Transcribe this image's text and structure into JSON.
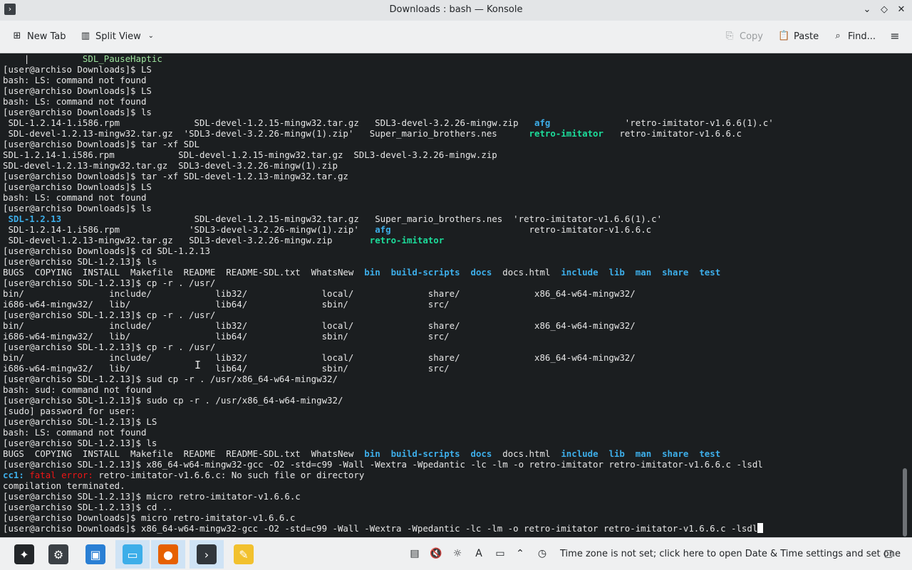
{
  "window": {
    "title": "Downloads : bash — Konsole",
    "controls": [
      "chevron-down",
      "diamond",
      "close"
    ]
  },
  "toolbar": {
    "new_tab": "New Tab",
    "split_view": "Split View",
    "copy": "Copy",
    "paste": "Paste",
    "find": "Find..."
  },
  "terminal": {
    "lines": [
      [
        {
          "t": "    |          "
        },
        {
          "t": "SDL_PauseHaptic",
          "c": "pale-green"
        }
      ],
      [
        {
          "t": "[user@archiso Downloads]$ LS"
        }
      ],
      [
        {
          "t": "bash: LS: command not found"
        }
      ],
      [
        {
          "t": "[user@archiso Downloads]$ LS"
        }
      ],
      [
        {
          "t": "bash: LS: command not found"
        }
      ],
      [
        {
          "t": "[user@archiso Downloads]$ ls"
        }
      ],
      [
        {
          "t": " SDL-1.2.14-1.i586.rpm              SDL-devel-1.2.15-mingw32.tar.gz   SDL3-devel-3.2.26-mingw.zip   "
        },
        {
          "t": "afg",
          "c": "blue"
        },
        {
          "t": "              'retro-imitator-v1.6.6(1).c'"
        }
      ],
      [
        {
          "t": " SDL-devel-1.2.13-mingw32.tar.gz  'SDL3-devel-3.2.26-mingw(1).zip'   Super_mario_brothers.nes      "
        },
        {
          "t": "retro-imitator",
          "c": "green"
        },
        {
          "t": "   retro-imitator-v1.6.6.c"
        }
      ],
      [
        {
          "t": "[user@archiso Downloads]$ tar -xf SDL"
        }
      ],
      [
        {
          "t": "SDL-1.2.14-1.i586.rpm            SDL-devel-1.2.15-mingw32.tar.gz  SDL3-devel-3.2.26-mingw.zip"
        }
      ],
      [
        {
          "t": "SDL-devel-1.2.13-mingw32.tar.gz  SDL3-devel-3.2.26-mingw(1).zip"
        }
      ],
      [
        {
          "t": "[user@archiso Downloads]$ tar -xf SDL-devel-1.2.13-mingw32.tar.gz"
        }
      ],
      [
        {
          "t": "[user@archiso Downloads]$ LS"
        }
      ],
      [
        {
          "t": "bash: LS: command not found"
        }
      ],
      [
        {
          "t": "[user@archiso Downloads]$ ls"
        }
      ],
      [
        {
          "t": " "
        },
        {
          "t": "SDL-1.2.13",
          "c": "blue"
        },
        {
          "t": "                         SDL-devel-1.2.15-mingw32.tar.gz   Super_mario_brothers.nes  'retro-imitator-v1.6.6(1).c'"
        }
      ],
      [
        {
          "t": " SDL-1.2.14-1.i586.rpm             'SDL3-devel-3.2.26-mingw(1).zip'   "
        },
        {
          "t": "afg",
          "c": "blue"
        },
        {
          "t": "                          retro-imitator-v1.6.6.c"
        }
      ],
      [
        {
          "t": " SDL-devel-1.2.13-mingw32.tar.gz   SDL3-devel-3.2.26-mingw.zip       "
        },
        {
          "t": "retro-imitator",
          "c": "green"
        }
      ],
      [
        {
          "t": "[user@archiso Downloads]$ cd SDL-1.2.13"
        }
      ],
      [
        {
          "t": "[user@archiso SDL-1.2.13]$ ls"
        }
      ],
      [
        {
          "t": "BUGS  COPYING  INSTALL  Makefile  README  README-SDL.txt  WhatsNew  "
        },
        {
          "t": "bin",
          "c": "blue"
        },
        {
          "t": "  "
        },
        {
          "t": "build-scripts",
          "c": "blue"
        },
        {
          "t": "  "
        },
        {
          "t": "docs",
          "c": "blue"
        },
        {
          "t": "  docs.html  "
        },
        {
          "t": "include",
          "c": "blue"
        },
        {
          "t": "  "
        },
        {
          "t": "lib",
          "c": "blue"
        },
        {
          "t": "  "
        },
        {
          "t": "man",
          "c": "blue"
        },
        {
          "t": "  "
        },
        {
          "t": "share",
          "c": "blue"
        },
        {
          "t": "  "
        },
        {
          "t": "test",
          "c": "blue"
        }
      ],
      [
        {
          "t": "[user@archiso SDL-1.2.13]$ cp -r . /usr/"
        }
      ],
      [
        {
          "t": "bin/                include/            lib32/              local/              share/              x86_64-w64-mingw32/"
        }
      ],
      [
        {
          "t": "i686-w64-mingw32/   lib/                lib64/              sbin/               src/"
        }
      ],
      [
        {
          "t": "[user@archiso SDL-1.2.13]$ cp -r . /usr/"
        }
      ],
      [
        {
          "t": "bin/                include/            lib32/              local/              share/              x86_64-w64-mingw32/"
        }
      ],
      [
        {
          "t": "i686-w64-mingw32/   lib/                lib64/              sbin/               src/"
        }
      ],
      [
        {
          "t": "[user@archiso SDL-1.2.13]$ cp -r . /usr/"
        }
      ],
      [
        {
          "t": "bin/                include/            lib32/              local/              share/              x86_64-w64-mingw32/"
        }
      ],
      [
        {
          "t": "i686-w64-mingw32/   lib/                lib64/              sbin/               src/"
        }
      ],
      [
        {
          "t": "[user@archiso SDL-1.2.13]$ sud cp -r . /usr/x86_64-w64-mingw32/"
        }
      ],
      [
        {
          "t": "bash: sud: command not found"
        }
      ],
      [
        {
          "t": "[user@archiso SDL-1.2.13]$ sudo cp -r . /usr/x86_64-w64-mingw32/"
        }
      ],
      [
        {
          "t": "[sudo] password for user:"
        }
      ],
      [
        {
          "t": "[user@archiso SDL-1.2.13]$ LS"
        }
      ],
      [
        {
          "t": "bash: LS: command not found"
        }
      ],
      [
        {
          "t": "[user@archiso SDL-1.2.13]$ ls"
        }
      ],
      [
        {
          "t": "BUGS  COPYING  INSTALL  Makefile  README  README-SDL.txt  WhatsNew  "
        },
        {
          "t": "bin",
          "c": "blue"
        },
        {
          "t": "  "
        },
        {
          "t": "build-scripts",
          "c": "blue"
        },
        {
          "t": "  "
        },
        {
          "t": "docs",
          "c": "blue"
        },
        {
          "t": "  docs.html  "
        },
        {
          "t": "include",
          "c": "blue"
        },
        {
          "t": "  "
        },
        {
          "t": "lib",
          "c": "blue"
        },
        {
          "t": "  "
        },
        {
          "t": "man",
          "c": "blue"
        },
        {
          "t": "  "
        },
        {
          "t": "share",
          "c": "blue"
        },
        {
          "t": "  "
        },
        {
          "t": "test",
          "c": "blue"
        }
      ],
      [
        {
          "t": "[user@archiso SDL-1.2.13]$ x86_64-w64-mingw32-gcc -O2 -std=c99 -Wall -Wextra -Wpedantic -lc -lm -o retro-imitator retro-imitator-v1.6.6.c -lsdl"
        }
      ],
      [
        {
          "t": "cc1:",
          "c": "blue"
        },
        {
          "t": " "
        },
        {
          "t": "fatal error:",
          "c": "red"
        },
        {
          "t": " retro-imitator-v1.6.6.c: No such file or directory"
        }
      ],
      [
        {
          "t": "compilation terminated."
        }
      ],
      [
        {
          "t": "[user@archiso SDL-1.2.13]$ micro retro-imitator-v1.6.6.c"
        }
      ],
      [
        {
          "t": "[user@archiso SDL-1.2.13]$ cd .."
        }
      ],
      [
        {
          "t": "[user@archiso Downloads]$ micro retro-imitator-v1.6.6.c"
        }
      ],
      [
        {
          "t": "[user@archiso Downloads]$ x86_64-w64-mingw32-gcc -O2 -std=c99 -Wall -Wextra -Wpedantic -lc -lm -o retro-imitator retro-imitator-v1.6.6.c -lsdl"
        },
        {
          "t": "",
          "c": "cursor"
        }
      ]
    ]
  },
  "taskbar": {
    "apps": [
      {
        "name": "application-launcher",
        "color": "#232629",
        "glyph": "✦",
        "active": false
      },
      {
        "name": "system-settings",
        "color": "#3b4045",
        "glyph": "⚙",
        "active": false
      },
      {
        "name": "discover",
        "color": "#2a7fd4",
        "glyph": "▣",
        "active": false
      },
      {
        "name": "dolphin-file-manager",
        "color": "#3daee9",
        "glyph": "▭",
        "active": true
      },
      {
        "name": "firefox",
        "color": "#e66000",
        "glyph": "●",
        "active": true
      },
      {
        "name": "konsole",
        "color": "#31363b",
        "glyph": "›",
        "active": true
      },
      {
        "name": "kate-editor",
        "color": "#f2c12e",
        "glyph": "✎",
        "active": false
      }
    ],
    "tray_icons": [
      "clipboard",
      "volume-muted",
      "brightness",
      "keyboard-layout",
      "display",
      "expand-tray"
    ],
    "tray_message": "Time zone is not set; click here to open Date & Time settings and set one"
  },
  "colors": {
    "green": "#1cdc9a",
    "blue": "#3daee9",
    "red": "#ed1515",
    "bg": "#1b1e20"
  }
}
